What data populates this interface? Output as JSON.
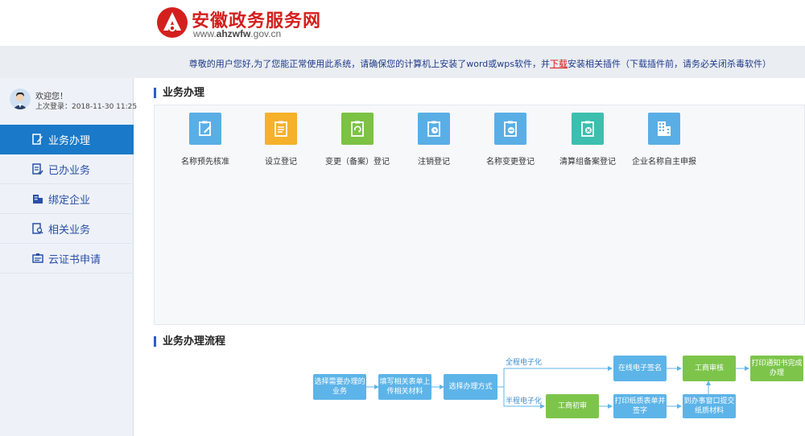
{
  "header": {
    "title": "安徽政务服务网",
    "url_bold": "ahzwfw",
    "url_prefix": "www.",
    "url_suffix": ".gov.cn"
  },
  "notice": {
    "before": "尊敬的用户您好,为了您能正常使用此系统，请确保您的计算机上安装了word或wps软件，并",
    "link": "下载",
    "after": "安装相关插件（下载插件前，请务必关闭杀毒软件）"
  },
  "user": {
    "welcome": "欢迎您！",
    "last_login": "上次登录：2018-11-30 11:25"
  },
  "nav": [
    {
      "label": "业务办理",
      "icon": "edit-doc-icon"
    },
    {
      "label": "已办业务",
      "icon": "done-doc-icon"
    },
    {
      "label": "绑定企业",
      "icon": "building-icon"
    },
    {
      "label": "相关业务",
      "icon": "search-doc-icon"
    },
    {
      "label": "云证书申请",
      "icon": "certificate-icon"
    }
  ],
  "main": {
    "section1": "业务办理",
    "section2": "业务办理流程",
    "tiles": [
      {
        "label": "名称预先核准",
        "color": "#5aaee6",
        "icon": "clipboard-edit-icon"
      },
      {
        "label": "设立登记",
        "color": "#f5b12a",
        "icon": "clipboard-icon"
      },
      {
        "label": "变更（备案）登记",
        "color": "#7cc243",
        "icon": "clipboard-refresh-icon"
      },
      {
        "label": "注销登记",
        "color": "#5aaee6",
        "icon": "clipboard-clock-icon"
      },
      {
        "label": "名称变更登记",
        "color": "#5aaee6",
        "icon": "clipboard-minus-icon"
      },
      {
        "label": "清算组备案登记",
        "color": "#3cbfae",
        "icon": "clipboard-close-icon"
      },
      {
        "label": "企业名称自主申报",
        "color": "#5aaee6",
        "icon": "office-building-icon"
      }
    ]
  },
  "flow": {
    "step1": "选择需要办理的业务",
    "step2": "填写相关表单上传相关材料",
    "step3": "选择办理方式",
    "branch_top": "全程电子化",
    "branch_bottom": "半程电子化",
    "top1": "在线电子签名",
    "top2": "工商审核",
    "top3": "打印通知书完成办理",
    "bot1": "工商初审",
    "bot2": "打印纸质表单并签字",
    "bot3": "到办事窗口提交纸质材料"
  }
}
